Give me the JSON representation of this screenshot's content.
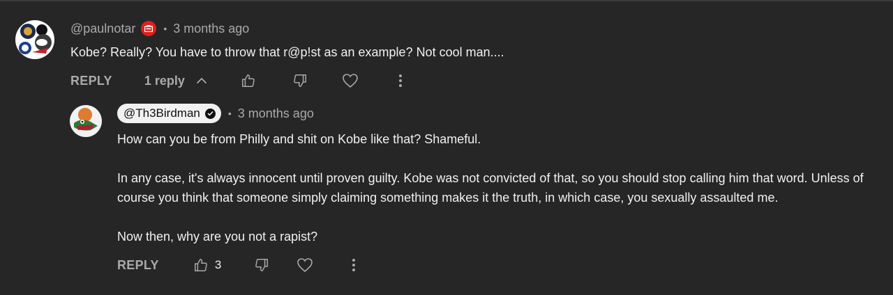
{
  "comment": {
    "author": "@paulnotar",
    "time": "3 months ago",
    "text": "Kobe?  Really?  You have to throw that r@p!st as an example?  Not cool man....",
    "reply_label": "REPLY",
    "replies_label": "1 reply",
    "icons": [
      "member-badge-icon",
      "chevron-up-icon",
      "thumbs-up-icon",
      "thumbs-down-icon",
      "heart-icon",
      "more-vert-icon"
    ]
  },
  "reply": {
    "author": "@Th3Birdman",
    "time": "3 months ago",
    "paragraphs": [
      "How can you be from Philly and shit on Kobe like that? Shameful.",
      "In any case, it's always innocent until proven guilty. Kobe was not convicted of that, so you should stop calling him that word. Unless of",
      "course you think that someone simply claiming something makes it the truth, in which case, you sexually assaulted me.",
      "Now then, why are you not a rapist?"
    ],
    "reply_label": "REPLY",
    "like_count": "3",
    "icons": [
      "verified-check-icon",
      "thumbs-up-icon",
      "thumbs-down-icon",
      "heart-icon",
      "more-vert-icon"
    ]
  },
  "colors": {
    "background": "#262626",
    "text_primary": "#f1f1f1",
    "text_secondary": "#aaaaaa",
    "badge_red": "#e0201b",
    "author_pill": "#f1f1f1"
  }
}
